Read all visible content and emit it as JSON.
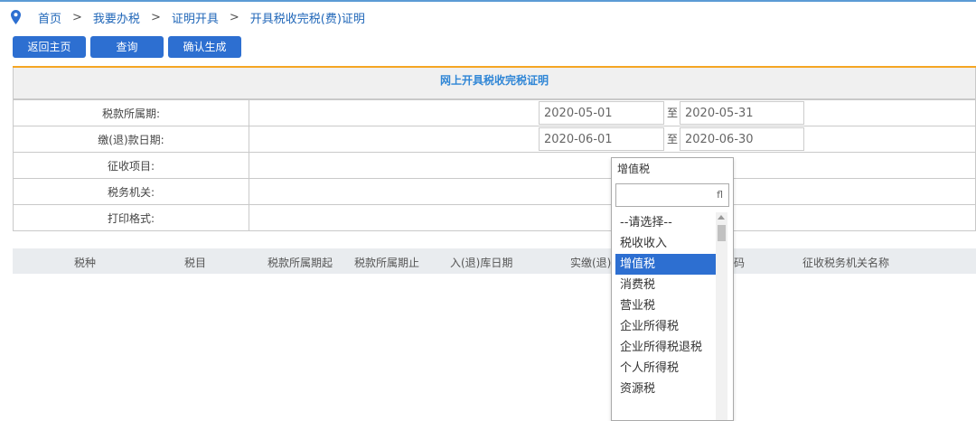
{
  "breadcrumb": {
    "home": "首页",
    "sep": ">",
    "level2": "我要办税",
    "level3": "证明开具",
    "current": "开具税收完税(费)证明"
  },
  "toolbar": {
    "back_label": "返回主页",
    "query_label": "查询",
    "confirm_label": "确认生成"
  },
  "form": {
    "title": "网上开具税收完税证明",
    "tax_period_label": "税款所属期:",
    "tax_period_start": "2020-05-01",
    "tax_period_to": "至",
    "tax_period_end": "2020-05-31",
    "pay_date_label": "缴(退)款日期:",
    "pay_date_start": "2020-06-01",
    "pay_date_to": "至",
    "pay_date_end": "2020-06-30",
    "levy_item_label": "征收项目:",
    "tax_office_label": "税务机关:",
    "print_format_label": "打印格式:"
  },
  "grid": {
    "columns": [
      "税种",
      "税目",
      "税款所属期起",
      "税款所属期止",
      "入(退)库日期",
      "实缴(退)",
      "码",
      "征收税务机关名称"
    ]
  },
  "dropdown": {
    "selected": "增值税",
    "search_icon_glyph": "fl",
    "options": [
      "--请选择--",
      "税收收入",
      "增值税",
      "消费税",
      "营业税",
      "企业所得税",
      "企业所得税退税",
      "个人所得税",
      "资源税"
    ]
  },
  "colors": {
    "accent": "#2d6fd1",
    "panel_top": "#f5a623",
    "title": "#2f86d6"
  }
}
